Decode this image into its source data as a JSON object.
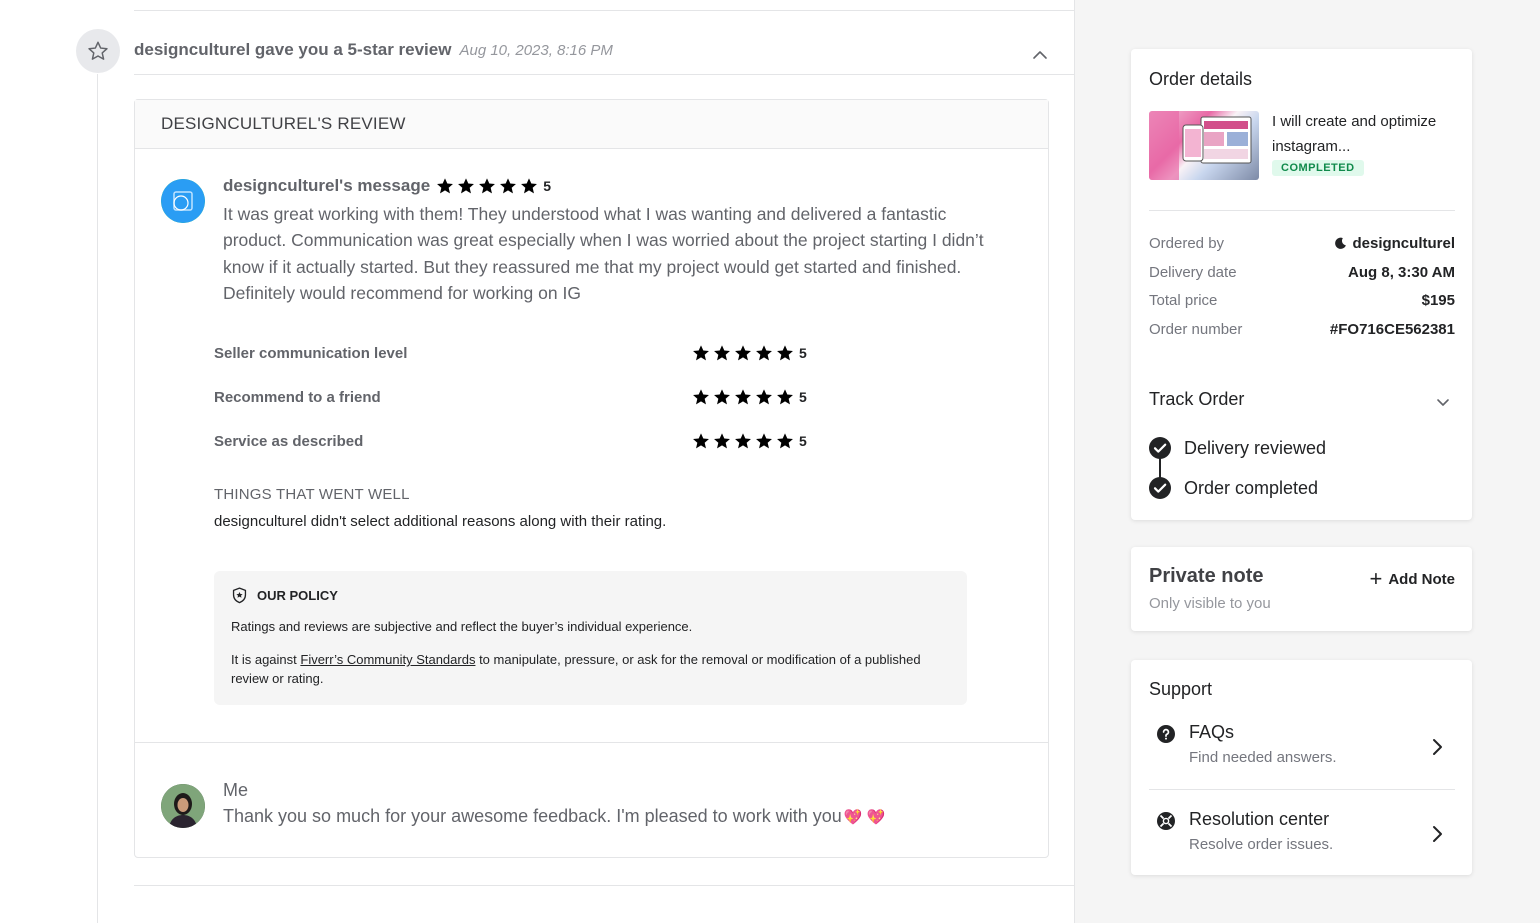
{
  "event": {
    "title": "designculturel gave you a 5-star review",
    "date": "Aug 10, 2023, 8:16 PM"
  },
  "review": {
    "header": "DESIGNCULTUREL'S REVIEW",
    "message_title": "designculturel's message",
    "overall_rating": "5",
    "message": "It was great working with them! They understood what I was wanting and delivered a fantastic product. Communication was great especially when I was worried about the project starting I didn’t know if it actually started. But they reassured me that my project would get started and finished. Definitely would recommend for working on IG",
    "criteria": [
      {
        "label": "Seller communication level",
        "rating": "5"
      },
      {
        "label": "Recommend to a friend",
        "rating": "5"
      },
      {
        "label": "Service as described",
        "rating": "5"
      }
    ],
    "went_well_title": "THINGS THAT WENT WELL",
    "went_well_text": "designculturel didn't select additional reasons along with their rating."
  },
  "policy": {
    "title": "OUR POLICY",
    "line1": "Ratings and reviews are subjective and reflect the buyer’s individual experience.",
    "line2_prefix": "It is against ",
    "line2_link": "Fiverr’s Community Standards",
    "line2_suffix": " to manipulate, pressure, or ask for the removal or modification of a published review or rating."
  },
  "reply": {
    "name": "Me",
    "text": "Thank you so much for your awesome feedback. I'm pleased to work with you",
    "hearts": "💖 💖"
  },
  "order": {
    "title": "Order details",
    "gig_title": "I will create and optimize instagram...",
    "status": "COMPLETED",
    "rows": [
      {
        "label": "Ordered by",
        "value": "designculturel"
      },
      {
        "label": "Delivery date",
        "value": "Aug 8, 3:30 AM"
      },
      {
        "label": "Total price",
        "value": "$195"
      },
      {
        "label": "Order number",
        "value": "#FO716CE562381"
      }
    ],
    "track_title": "Track Order",
    "steps": [
      "Delivery reviewed",
      "Order completed"
    ]
  },
  "note": {
    "title": "Private note",
    "subtitle": "Only visible to you",
    "add_label": "Add Note"
  },
  "support": {
    "title": "Support",
    "items": [
      {
        "title": "FAQs",
        "subtitle": "Find needed answers.",
        "icon": "question-icon"
      },
      {
        "title": "Resolution center",
        "subtitle": "Resolve order issues.",
        "icon": "lifebuoy-icon"
      }
    ]
  },
  "colors": {
    "accent_green": "#1dbf73",
    "badge_bg": "#e0f9ec",
    "badge_text": "#108a4b",
    "star": "#222325"
  }
}
